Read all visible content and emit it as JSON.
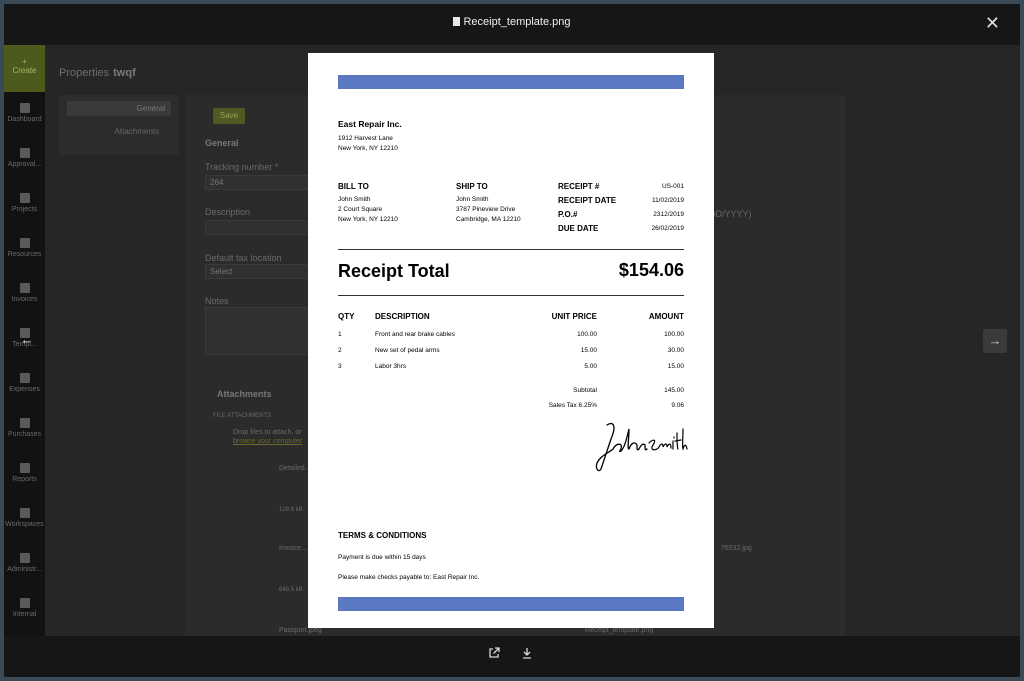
{
  "viewer": {
    "file_name": "Receipt_template.png"
  },
  "background_app": {
    "create_label": "Create",
    "nav": [
      "Dashboard",
      "Approval...",
      "Projects",
      "Resources",
      "Invoices",
      "Templ...",
      "Expenses",
      "Purchases",
      "Reports",
      "Workspaces",
      "Administr...",
      "Internal"
    ],
    "properties_title": "Properties",
    "properties_name": "twqf",
    "tab_general": "General",
    "tab_attachments": "Attachments",
    "save_label": "Save",
    "section_general": "General",
    "tracking_label": "Tracking number *",
    "tracking_value": "264",
    "description_label": "Description",
    "tax_label": "Default tax location",
    "tax_value": "Select",
    "notes_label": "Notes",
    "attachments_label": "Attachments",
    "file_attachments_label": "FILE ATTACHMENTS",
    "drop_text": "Drop files to attach, or",
    "browse_text": "browse your computer",
    "date_format_hint": "DD/YYYY)",
    "att_items": [
      "Detailed...",
      "Invoice....",
      "Passport.jpeg",
      "76532.jpg",
      "Receipt_template.png"
    ],
    "att_sizes": [
      "128.6 kB",
      "649.5 kB"
    ]
  },
  "receipt": {
    "company": "East Repair Inc.",
    "address_line1": "1912 Harvest Lane",
    "address_line2": "New York, NY 12210",
    "bill_to_label": "BILL TO",
    "bill_to": [
      "John Smith",
      "2 Court Square",
      "New York, NY 12210"
    ],
    "ship_to_label": "SHIP TO",
    "ship_to": [
      "John Smith",
      "3787 Pineview Drive",
      "Cambridge, MA 12210"
    ],
    "meta": [
      {
        "label": "RECEIPT #",
        "value": "US-001"
      },
      {
        "label": "RECEIPT DATE",
        "value": "11/02/2019"
      },
      {
        "label": "P.O.#",
        "value": "2312/2019"
      },
      {
        "label": "DUE DATE",
        "value": "26/02/2019"
      }
    ],
    "total_label": "Receipt Total",
    "total_value": "$154.06",
    "columns": {
      "qty": "QTY",
      "description": "DESCRIPTION",
      "unit_price": "UNIT PRICE",
      "amount": "AMOUNT"
    },
    "items": [
      {
        "qty": "1",
        "description": "Front and rear brake cables",
        "unit_price": "100.00",
        "amount": "100.00"
      },
      {
        "qty": "2",
        "description": "New set of pedal arms",
        "unit_price": "15.00",
        "amount": "30.00"
      },
      {
        "qty": "3",
        "description": "Labor 3hrs",
        "unit_price": "5.00",
        "amount": "15.00"
      }
    ],
    "subtotal_label": "Subtotal",
    "subtotal_value": "145.00",
    "tax_label": "Sales Tax 6.25%",
    "tax_value": "9.06",
    "signature_text": "John Smith",
    "terms_label": "TERMS & CONDITIONS",
    "terms_line1": "Payment is due within 15 days",
    "terms_line2": "Please make checks payable to: East Repair Inc.",
    "band_color": "#5b79c2"
  },
  "icons": {
    "close": "close-icon",
    "prev": "arrow-left-icon",
    "next": "arrow-right-icon",
    "open_external": "external-link-icon",
    "download": "download-icon"
  }
}
